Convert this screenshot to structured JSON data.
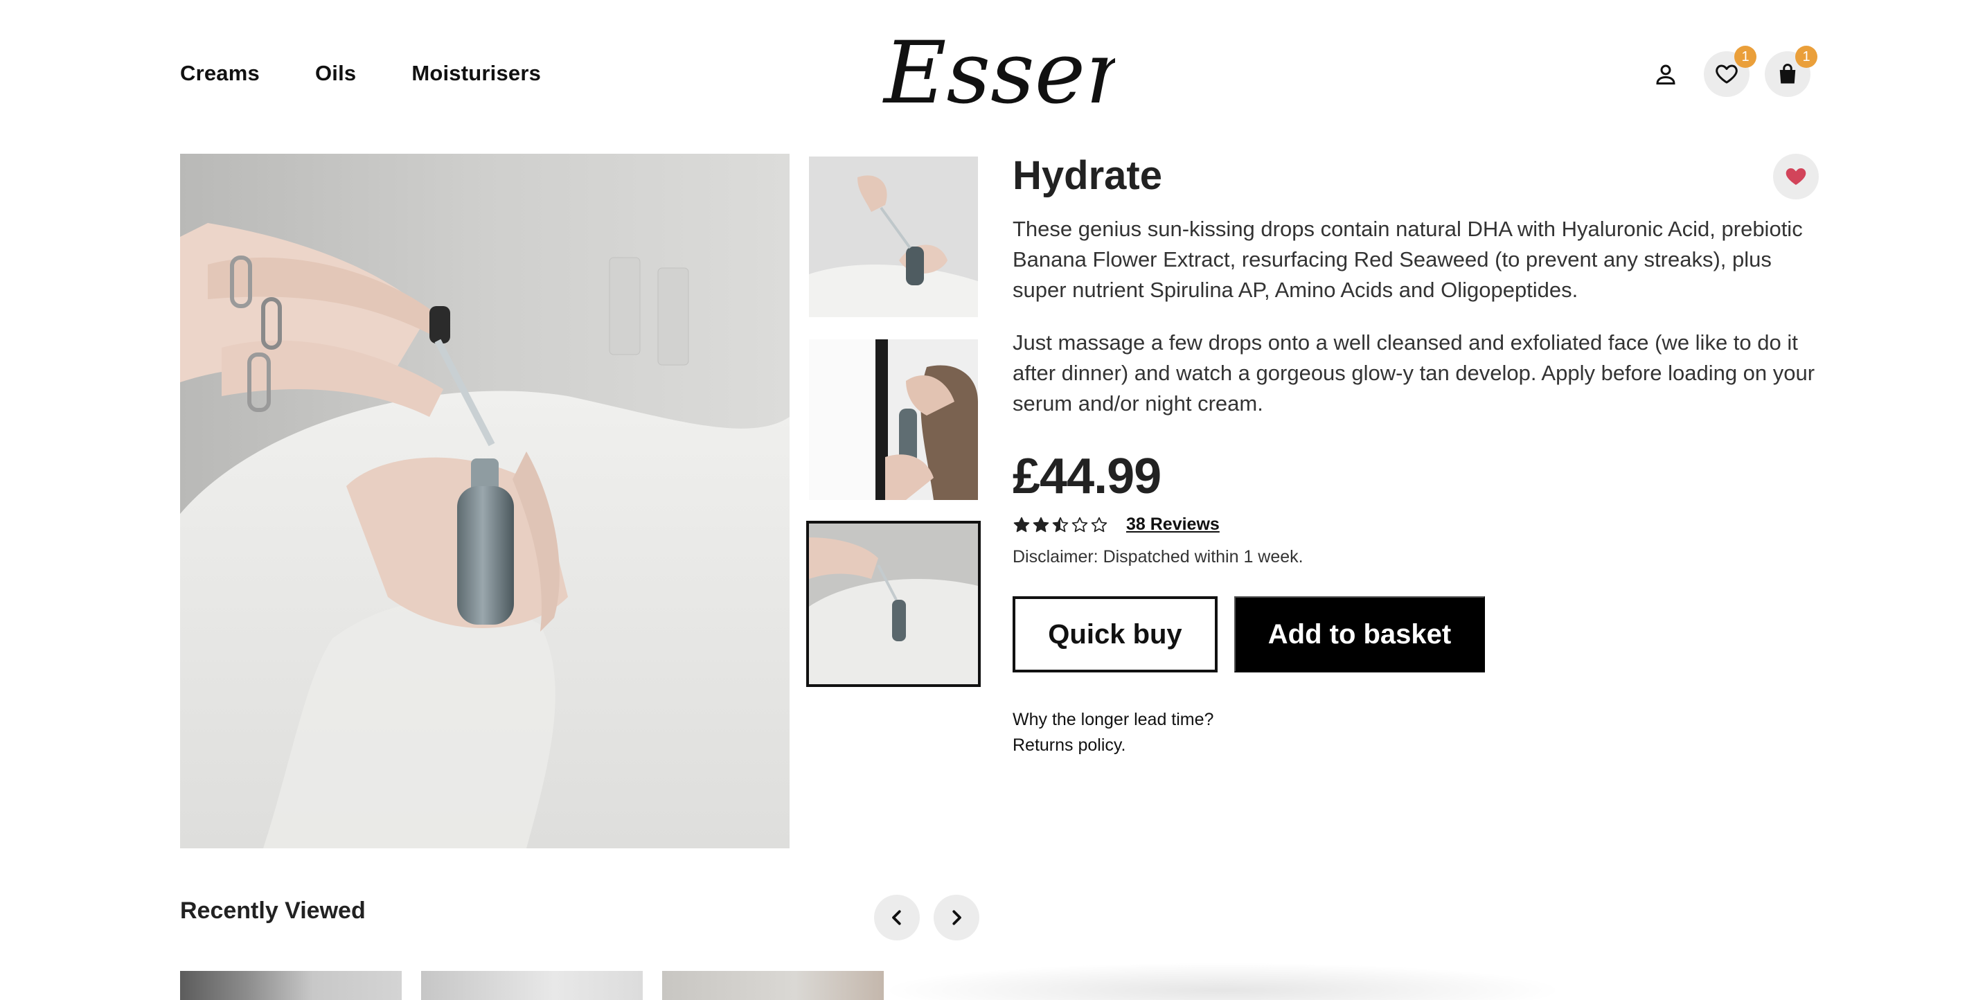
{
  "header": {
    "nav": [
      "Creams",
      "Oils",
      "Moisturisers"
    ],
    "logo_text": "Essence",
    "account_icon": "user-icon",
    "wishlist_icon": "heart-outline-icon",
    "wishlist_count": "1",
    "basket_icon": "shopping-bag-icon",
    "basket_count": "1",
    "badge_color": "#ea9f3a"
  },
  "gallery": {
    "main_image": "woman-holding-serum-dropper-bottle",
    "thumbnails": [
      "hands-with-dropper-bottle",
      "person-holding-bottle-near-mirror",
      "woman-holding-serum-dropper-bottle"
    ],
    "selected_thumbnail": 3
  },
  "product": {
    "name": "Hydrate",
    "favourite_icon": "heart-filled-icon",
    "favourite_color": "#d2445a",
    "description_1": "These genius sun-kissing drops contain natural DHA with Hyaluronic Acid, prebiotic Banana Flower Extract, resurfacing Red Seaweed (to prevent any streaks), plus super nutrient Spirulina AP, Amino Acids and Oligopeptides.",
    "description_2": "Just massage a few drops onto a well cleansed and exfoliated face (we like to do it after dinner) and watch a gorgeous glow-y tan develop. Apply before loading on your serum and/or night cream.",
    "price": "£44.99",
    "rating": 2.5,
    "rating_max": 5,
    "reviews_link": "38 Reviews",
    "disclaimer": "Disclaimer: Dispatched within 1 week.",
    "quick_buy_label": "Quick buy",
    "add_to_basket_label": "Add to basket",
    "lead_time_link": "Why the longer lead time?",
    "returns_link": "Returns policy."
  },
  "recently_viewed": {
    "title": "Recently Viewed",
    "prev_icon": "chevron-left-icon",
    "next_icon": "chevron-right-icon"
  }
}
